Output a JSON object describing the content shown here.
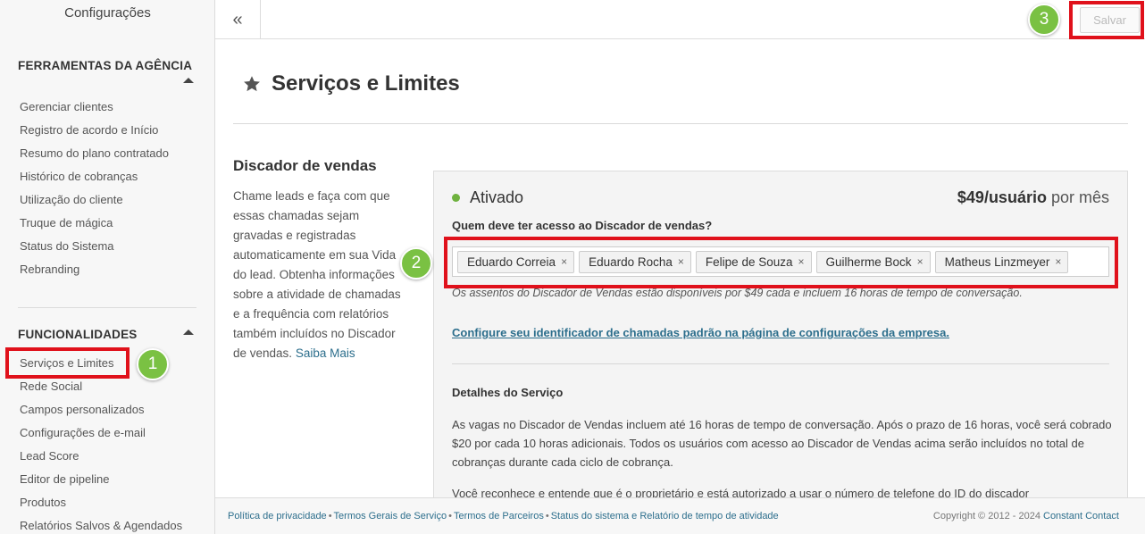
{
  "sidebar": {
    "title": "Configurações",
    "sections": [
      {
        "heading": "FERRAMENTAS DA AGÊNCIA",
        "items": [
          "Gerenciar clientes",
          "Registro de acordo e Início",
          "Resumo do plano contratado",
          "Histórico de cobranças",
          "Utilização do cliente",
          "Truque de mágica",
          "Status do Sistema",
          "Rebranding"
        ]
      },
      {
        "heading": "FUNCIONALIDADES",
        "items": [
          "Serviços e Limites",
          "Rede Social",
          "Campos personalizados",
          "Configurações de e-mail",
          "Lead Score",
          "Editor de pipeline",
          "Produtos",
          "Relatórios Salvos & Agendados"
        ]
      }
    ]
  },
  "topbar": {
    "collapse_icon": "«",
    "save_label": "Salvar"
  },
  "page": {
    "title": "Serviços e Limites",
    "title_icon": "star-icon"
  },
  "feature": {
    "name": "Discador de vendas",
    "description": "Chame leads e faça com que essas chamadas sejam gravadas e registradas automaticamente em sua Vida do lead. Obtenha informações sobre a atividade de chamadas e a frequência com relatórios também incluídos no Discador de vendas.",
    "learn_more": "Saiba Mais"
  },
  "card": {
    "status": "Ativado",
    "status_color": "#6fb23f",
    "price_amount": "$49/usuário",
    "price_period": "por mês",
    "access_label": "Quem deve ter acesso ao Discador de vendas?",
    "users": [
      "Eduardo Correia",
      "Eduardo Rocha",
      "Felipe de Souza",
      "Guilherme Bock",
      "Matheus Linzmeyer"
    ],
    "remove_glyph": "×",
    "note": "Os assentos do Discador de Vendas estão disponíveis por $49 cada e incluem 16 horas de tempo de conversação.",
    "config_link": "Configure seu identificador de chamadas padrão na página de configurações da empresa.",
    "details_title": "Detalhes do Serviço",
    "details_text": "As vagas no Discador de Vendas incluem até 16 horas de tempo de conversação. Após o prazo de 16 horas, você será cobrado $20 por cada 10 horas adicionais. Todos os usuários com acesso ao Discador de Vendas acima serão incluídos no total de cobranças durante cada ciclo de cobrança.",
    "details_text_2": "Você reconhece e entende que é o proprietário e está autorizado a usar o número de telefone do ID do discador"
  },
  "footer": {
    "links": [
      "Política de privacidade",
      "Termos Gerais de Serviço",
      "Termos de Parceiros",
      "Status do sistema e Relatório de tempo de atividade"
    ],
    "separator": "•",
    "copyright": "Copyright © 2012 - 2024",
    "brand": "Constant Contact"
  },
  "annotations": {
    "steps": [
      "1",
      "2",
      "3"
    ],
    "highlight_color": "#e0111b",
    "badge_color": "#7ac143"
  }
}
